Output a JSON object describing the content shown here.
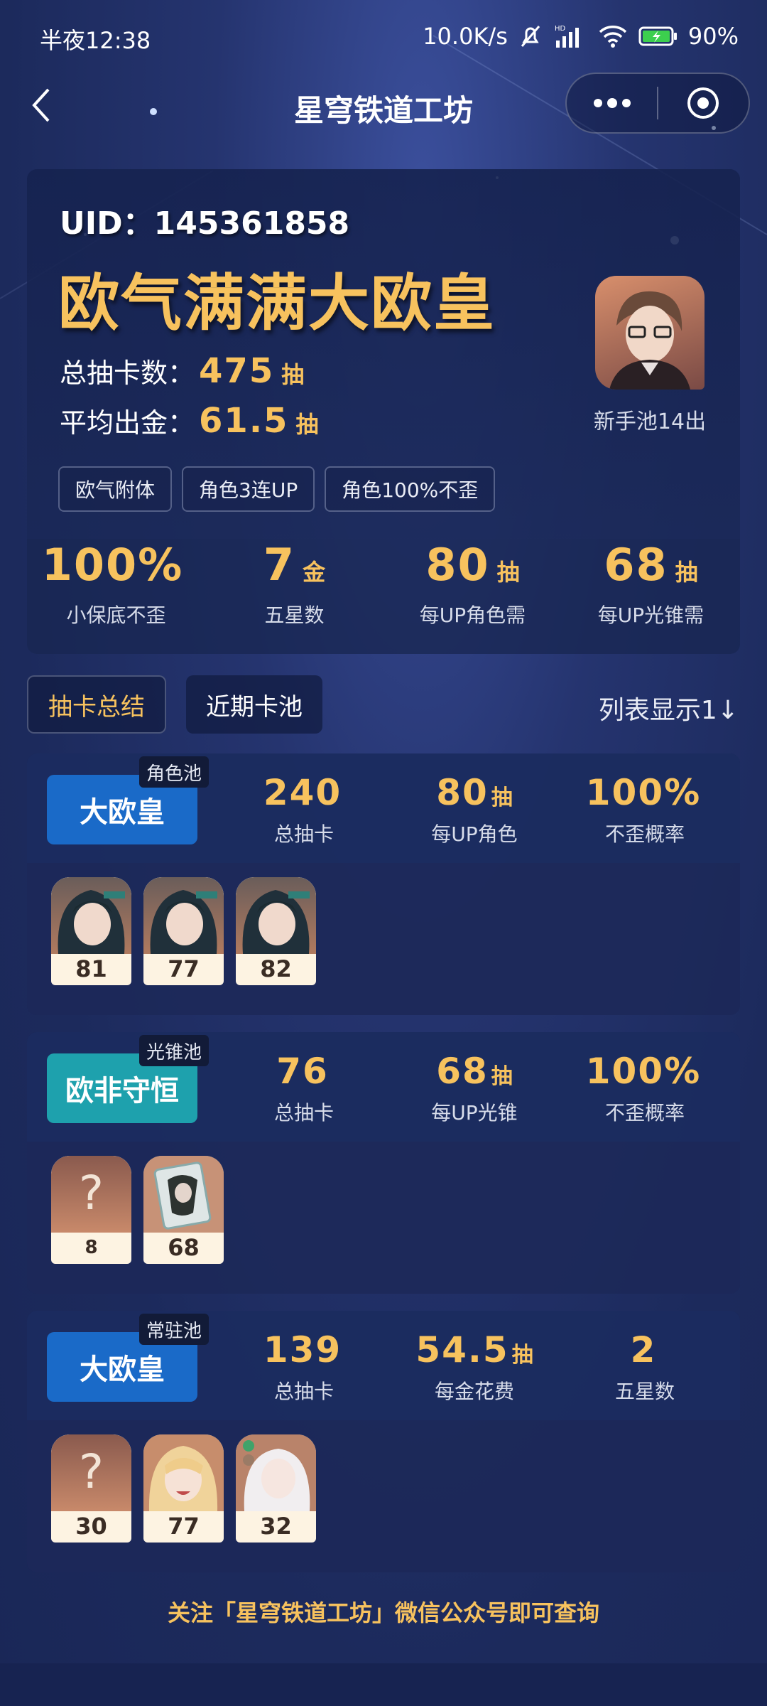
{
  "status": {
    "time": "半夜12:38",
    "speed": "10.0K/s",
    "battery": "90%"
  },
  "nav": {
    "title": "星穹铁道工坊"
  },
  "summary": {
    "uid": "UID：145361858",
    "rank_title": "欧气满满大欧皇",
    "total_label": "总抽卡数：",
    "total_value": "475",
    "total_unit": "抽",
    "avg_label": "平均出金：",
    "avg_value": "61.5",
    "avg_unit": "抽",
    "avatar_caption": "新手池14出",
    "tags": [
      "欧气附体",
      "角色3连UP",
      "角色100%不歪"
    ],
    "stats": [
      {
        "value": "100%",
        "unit": "",
        "label": "小保底不歪"
      },
      {
        "value": "7",
        "unit": "金",
        "label": "五星数"
      },
      {
        "value": "80",
        "unit": "抽",
        "label": "每UP角色需"
      },
      {
        "value": "68",
        "unit": "抽",
        "label": "每UP光锥需"
      }
    ]
  },
  "tabs": {
    "summary": "抽卡总结",
    "recent": "近期卡池",
    "list_toggle": "列表显示1↓"
  },
  "pools": [
    {
      "badge": "大欧皇",
      "tag": "角色池",
      "badge_color": "#1a6ac8",
      "stats": [
        {
          "value": "240",
          "unit": "",
          "label": "总抽卡"
        },
        {
          "value": "80",
          "unit": "抽",
          "label": "每UP角色"
        },
        {
          "value": "100%",
          "unit": "",
          "label": "不歪概率"
        }
      ],
      "chars": [
        "81",
        "77",
        "82"
      ]
    },
    {
      "badge": "欧非守恒",
      "tag": "光锥池",
      "badge_color": "#1ea1ad",
      "stats": [
        {
          "value": "76",
          "unit": "",
          "label": "总抽卡"
        },
        {
          "value": "68",
          "unit": "抽",
          "label": "每UP光锥"
        },
        {
          "value": "100%",
          "unit": "",
          "label": "不歪概率"
        }
      ],
      "chars": [
        "8",
        "68"
      ]
    },
    {
      "badge": "大欧皇",
      "tag": "常驻池",
      "badge_color": "#1a6ac8",
      "stats": [
        {
          "value": "139",
          "unit": "",
          "label": "总抽卡"
        },
        {
          "value": "54.5",
          "unit": "抽",
          "label": "每金花费"
        },
        {
          "value": "2",
          "unit": "",
          "label": "五星数"
        }
      ],
      "chars": [
        "30",
        "77",
        "32"
      ]
    }
  ],
  "footer": "关注「星穹铁道工坊」微信公众号即可查询"
}
